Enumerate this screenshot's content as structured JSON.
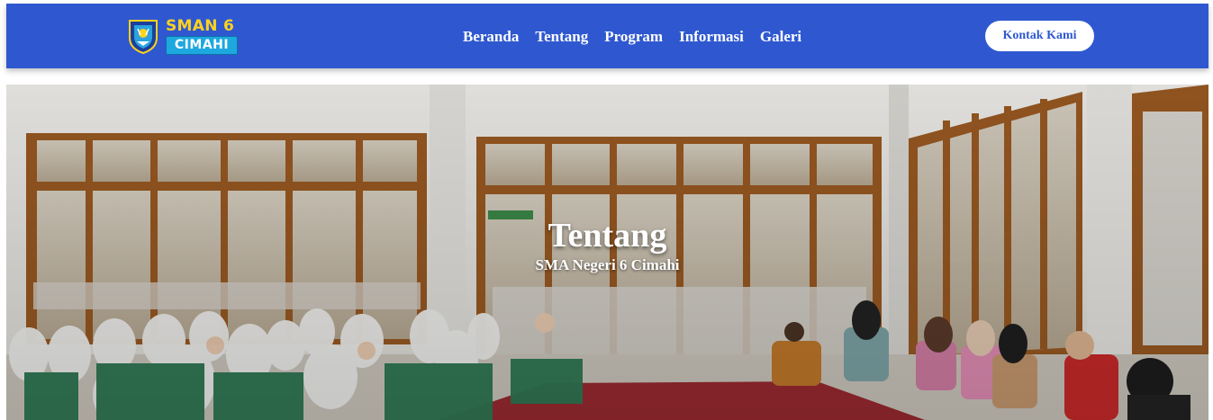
{
  "header": {
    "logo": {
      "line1": "SMAN 6",
      "line2": "CIMAHI"
    },
    "nav": [
      {
        "label": "Beranda"
      },
      {
        "label": "Tentang"
      },
      {
        "label": "Program"
      },
      {
        "label": "Informasi"
      },
      {
        "label": "Galeri"
      }
    ],
    "contact_button": "Kontak Kami"
  },
  "hero": {
    "title": "Tentang",
    "subtitle": "SMA Negeri 6 Cimahi"
  },
  "colors": {
    "navbar": "#2f58d0",
    "logo_yellow": "#ffd21f",
    "logo_blue": "#1ea8e0",
    "button_bg": "#ffffff",
    "button_text": "#2f58d0"
  }
}
